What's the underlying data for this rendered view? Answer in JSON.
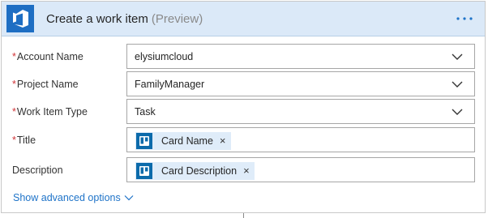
{
  "header": {
    "title": "Create a work item",
    "subtitle": "(Preview)",
    "more_label": "···",
    "logo_icon": "visual-studio-team-services-icon",
    "accent": "#1e6ec3"
  },
  "fields": [
    {
      "label": "Account Name",
      "required": true,
      "type": "dropdown",
      "value": "elysiumcloud"
    },
    {
      "label": "Project Name",
      "required": true,
      "type": "dropdown",
      "value": "FamilyManager"
    },
    {
      "label": "Work Item Type",
      "required": true,
      "type": "dropdown",
      "value": "Task"
    },
    {
      "label": "Title",
      "required": true,
      "type": "token",
      "token": "Card Name",
      "token_icon": "trello-icon"
    },
    {
      "label": "Description",
      "required": false,
      "type": "token",
      "token": "Card Description",
      "token_icon": "trello-icon"
    }
  ],
  "required_marker": "*",
  "footer": {
    "advanced_label": "Show advanced options"
  }
}
